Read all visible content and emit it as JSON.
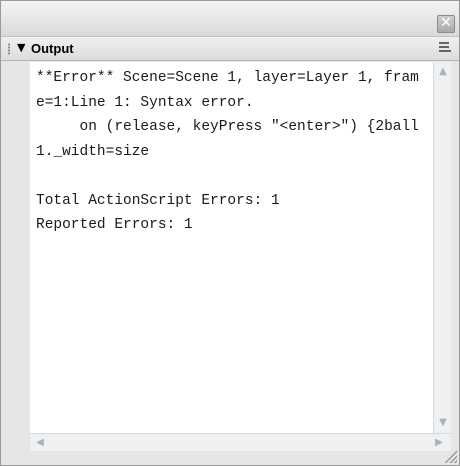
{
  "window": {
    "close_glyph": "✕"
  },
  "panel": {
    "title": "Output",
    "collapse_glyph": "▼"
  },
  "output": {
    "text": "**Error** Scene=Scene 1, layer=Layer 1, frame=1:Line 1: Syntax error.\n     on (release, keyPress \"<enter>\") {2ball1._width=size\n\nTotal ActionScript Errors: 1\nReported Errors: 1"
  },
  "scroll": {
    "up": "▲",
    "down": "▼",
    "left": "◀",
    "right": "▶"
  },
  "colors": {
    "content_bg": "#ffffff",
    "chrome_bg": "#e6e6e6",
    "scroll_arrow": "#a7b2bd"
  }
}
